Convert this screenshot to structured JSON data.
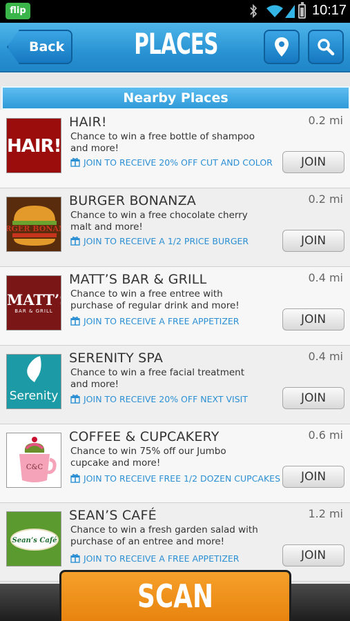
{
  "status_bar": {
    "app_icon_text": "flip",
    "time": "10:17"
  },
  "header": {
    "back_label": "Back",
    "title": "PLACES",
    "location_icon": "map-pin-icon",
    "search_icon": "search-icon"
  },
  "section": {
    "title": "Nearby Places"
  },
  "places": [
    {
      "name": "HAIR!",
      "description": "Chance to win a free bottle of shampoo and more!",
      "promo": "JOIN TO RECEIVE 20% OFF CUT AND COLOR",
      "distance": "0.2 mi",
      "join_label": "JOIN",
      "logo_text": "HAIR!"
    },
    {
      "name": "BURGER BONANZA",
      "description": "Chance to win a free chocolate cherry malt and more!",
      "promo": "JOIN TO RECEIVE A 1/2 PRICE BURGER",
      "distance": "0.2 mi",
      "join_label": "JOIN",
      "logo_text": "BURGER BONANZA"
    },
    {
      "name": "MATT’S BAR & GRILL",
      "description": "Chance to win a free entree with purchase of regular drink and more!",
      "promo": "JOIN TO RECEIVE A FREE APPETIZER",
      "distance": "0.4 mi",
      "join_label": "JOIN",
      "logo_text": "MATT’S",
      "logo_subtext": "BAR & GRILL"
    },
    {
      "name": "SERENITY SPA",
      "description": "Chance to win a free facial treatment and more!",
      "promo": "JOIN TO RECEIVE 20% OFF NEXT VISIT",
      "distance": "0.4 mi",
      "join_label": "JOIN",
      "logo_text": "Serenity"
    },
    {
      "name": "COFFEE & CUPCAKERY",
      "description": "Chance to win 75% off our Jumbo cupcake and more!",
      "promo": "JOIN TO RECEIVE FREE 1/2 DOZEN CUPCAKES",
      "distance": "0.6 mi",
      "join_label": "JOIN",
      "logo_text": "C&C"
    },
    {
      "name": "SEAN’S CAFÉ",
      "description": "Chance to win a fresh garden salad with purchase of an entree and more!",
      "promo": "JOIN TO RECEIVE A FREE APPETIZER",
      "distance": "1.2 mi",
      "join_label": "JOIN",
      "logo_text": "Sean’s Café"
    }
  ],
  "bottom": {
    "scan_label": "SCAN"
  },
  "colors": {
    "header_blue": "#2a93d3",
    "promo_blue": "#2b8fd4",
    "scan_orange": "#f29a25"
  }
}
